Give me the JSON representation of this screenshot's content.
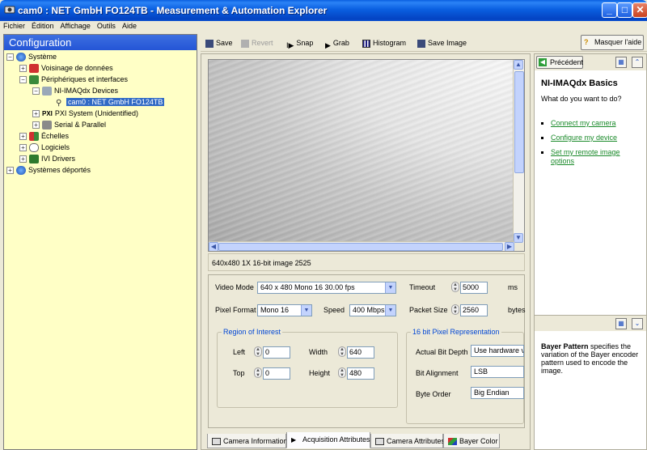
{
  "window": {
    "title": "cam0 : NET GmbH FO124TB - Measurement & Automation Explorer",
    "minimize": "_",
    "maximize": "□",
    "close": "✕"
  },
  "menu": [
    "Fichier",
    "Édition",
    "Affichage",
    "Outils",
    "Aide"
  ],
  "left_panel": {
    "header": "Configuration",
    "tree": [
      {
        "label": "Système",
        "expander": "−",
        "icon": "globe-icon"
      },
      {
        "label": "Voisinage de données",
        "expander": "+",
        "icon": "data-neighborhood-icon"
      },
      {
        "label": "Périphériques et interfaces",
        "expander": "−",
        "icon": "devices-icon"
      },
      {
        "label": "NI-IMAQdx Devices",
        "expander": "−",
        "icon": "imaqdx-icon"
      },
      {
        "label": "cam0 : NET GmbH FO124TB",
        "expander": "",
        "icon": "camera-icon",
        "selected": true
      },
      {
        "label": "PXI System (Unidentified)",
        "expander": "+",
        "icon": "pxi-icon",
        "prefix": "PXI"
      },
      {
        "label": "Serial & Parallel",
        "expander": "+",
        "icon": "serial-port-icon"
      },
      {
        "label": "Échelles",
        "expander": "+",
        "icon": "scales-icon"
      },
      {
        "label": "Logiciels",
        "expander": "+",
        "icon": "software-icon"
      },
      {
        "label": "IVI Drivers",
        "expander": "+",
        "icon": "ivi-drivers-icon"
      },
      {
        "label": "Systèmes déportés",
        "expander": "+",
        "icon": "remote-systems-icon"
      }
    ]
  },
  "toolbar": {
    "save": "Save",
    "revert": "Revert",
    "snap": "Snap",
    "grab": "Grab",
    "histogram": "Histogram",
    "save_image": "Save Image",
    "hide_help": "Masquer l'aide"
  },
  "image_status": "640x480   1X   16-bit image   2525",
  "acquisition": {
    "video_mode_label": "Video Mode",
    "video_mode_value": "640 x 480 Mono 16 30.00 fps",
    "pixel_format_label": "Pixel Format",
    "pixel_format_value": "Mono 16",
    "speed_label": "Speed",
    "speed_value": "400 Mbps",
    "timeout_label": "Timeout",
    "timeout_value": "5000",
    "timeout_unit": "ms",
    "packet_size_label": "Packet Size",
    "packet_size_value": "2560",
    "packet_size_unit": "bytes",
    "roi_title": "Region of Interest",
    "left_label": "Left",
    "left_value": "0",
    "top_label": "Top",
    "top_value": "0",
    "width_label": "Width",
    "width_value": "640",
    "height_label": "Height",
    "height_value": "480",
    "bitrep_title": "16 bit Pixel Representation",
    "actual_bit_depth_label": "Actual Bit Depth",
    "actual_bit_depth_value": "Use hardware va",
    "bit_alignment_label": "Bit Alignment",
    "bit_alignment_value": "LSB",
    "byte_order_label": "Byte Order",
    "byte_order_value": "Big Endian"
  },
  "tabs": [
    "Camera Information",
    "Acquisition Attributes",
    "Camera Attributes",
    "Bayer Color"
  ],
  "help": {
    "back": "Précédent",
    "title": "NI-IMAQdx Basics",
    "question": "What do you want to do?",
    "links": [
      "Connect my camera",
      "Configure my device",
      "Set my remote image options"
    ],
    "bayer_bold": "Bayer Pattern",
    "bayer_text": " specifies the variation of the Bayer encoder pattern used to encode the image."
  }
}
